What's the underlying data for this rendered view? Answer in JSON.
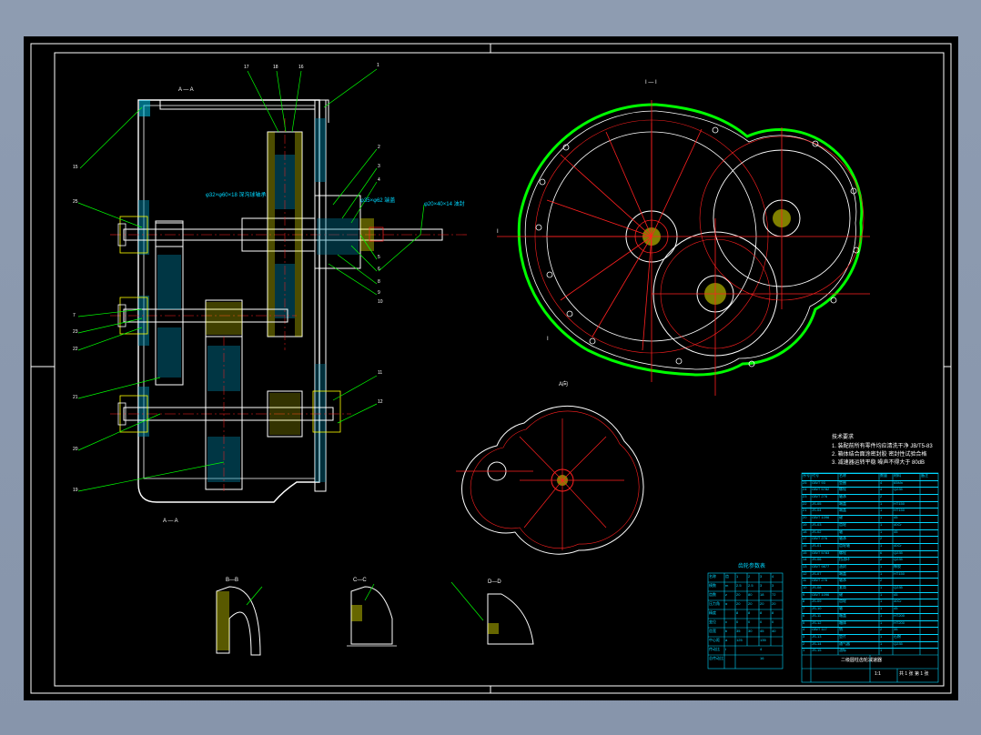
{
  "drawing": {
    "section_aa_label": "A — A",
    "section_bb_label": "B—B",
    "section_cc_label": "C—C",
    "section_dd_label": "D—D",
    "view_label_1": "I — I",
    "view_label_2": "I",
    "view_label_3": "I",
    "small_view_label": "A向",
    "part_numbers_left": [
      "15",
      "25",
      "7",
      "23",
      "22",
      "21",
      "20",
      "19"
    ],
    "part_numbers_top": [
      "17",
      "18",
      "16",
      "1"
    ],
    "part_numbers_right": [
      "2",
      "3",
      "4",
      "5",
      "6",
      "8",
      "9",
      "10",
      "11",
      "12"
    ],
    "callout_note_1": "φ32×φ60×18 深沟球轴承",
    "callout_note_2": "φ35×φ62 端盖",
    "callout_note_3": "φ20×40×14 油封",
    "tech_req_title": "技术要求",
    "tech_req_lines": [
      "1. 装配前所有零件均应清洗干净 JB/T5-83",
      "2. 箱体结合面涂密封胶 密封性试验合格",
      "3. 减速器运转平稳 噪声不得大于 80dB"
    ]
  },
  "param_table": {
    "title": "齿轮参数表",
    "rows": [
      [
        "名称",
        "齿",
        "1",
        "2",
        "3",
        "4"
      ],
      [
        "模数",
        "m",
        "2.5",
        "2.5",
        "3",
        "3"
      ],
      [
        "齿数",
        "z",
        "20",
        "80",
        "18",
        "72"
      ],
      [
        "压力角",
        "α",
        "20",
        "20",
        "20",
        "20"
      ],
      [
        "精度",
        "",
        "8",
        "8",
        "8",
        "8"
      ],
      [
        "变位",
        "x",
        "0",
        "0",
        "0",
        "0"
      ],
      [
        "齿宽",
        "b",
        "35",
        "30",
        "45",
        "40"
      ],
      [
        "中心距",
        "a",
        "125",
        "",
        "135",
        ""
      ],
      [
        "传动比",
        "i",
        "",
        "",
        "4",
        ""
      ],
      [
        "总传动比",
        "",
        "",
        "",
        "16",
        ""
      ]
    ]
  },
  "parts_list": {
    "header": [
      "序号",
      "代号",
      "名称",
      "数量",
      "材料",
      "备注"
    ],
    "rows": [
      [
        "25",
        "GB/T 93",
        "垫圈",
        "4",
        "65Mn",
        ""
      ],
      [
        "24",
        "GB/T 5782",
        "螺栓",
        "4",
        "Q235",
        ""
      ],
      [
        "23",
        "GB/T 276",
        "轴承",
        "2",
        "",
        ""
      ],
      [
        "22",
        "JS-05",
        "端盖",
        "1",
        "HT150",
        ""
      ],
      [
        "21",
        "JS-04",
        "端盖",
        "1",
        "HT150",
        ""
      ],
      [
        "20",
        "GB/T 1096",
        "键",
        "1",
        "45",
        ""
      ],
      [
        "19",
        "JS-03",
        "齿轮",
        "1",
        "40Cr",
        ""
      ],
      [
        "18",
        "JS-02",
        "轴",
        "1",
        "45",
        ""
      ],
      [
        "17",
        "GB/T 276",
        "轴承",
        "2",
        "",
        ""
      ],
      [
        "16",
        "JS-01",
        "齿轮轴",
        "1",
        "40Cr",
        ""
      ],
      [
        "15",
        "GB/T 5783",
        "螺栓",
        "6",
        "Q235",
        ""
      ],
      [
        "14",
        "JS-06",
        "挡油环",
        "2",
        "Q235",
        ""
      ],
      [
        "13",
        "GB/T 9877",
        "油封",
        "1",
        "橡胶",
        ""
      ],
      [
        "12",
        "JS-07",
        "端盖",
        "1",
        "HT150",
        ""
      ],
      [
        "11",
        "GB/T 276",
        "轴承",
        "2",
        "",
        ""
      ],
      [
        "10",
        "JS-08",
        "套筒",
        "1",
        "Q235",
        ""
      ],
      [
        "9",
        "GB/T 1096",
        "键",
        "1",
        "45",
        ""
      ],
      [
        "8",
        "JS-09",
        "齿轮",
        "1",
        "40Cr",
        ""
      ],
      [
        "7",
        "JS-10",
        "轴",
        "1",
        "45",
        ""
      ],
      [
        "6",
        "JS-11",
        "箱盖",
        "1",
        "HT200",
        ""
      ],
      [
        "5",
        "JS-12",
        "箱体",
        "1",
        "HT200",
        ""
      ],
      [
        "4",
        "GB/T 117",
        "销",
        "2",
        "35",
        ""
      ],
      [
        "3",
        "JS-13",
        "垫片",
        "1",
        "石棉",
        ""
      ],
      [
        "2",
        "JS-14",
        "通气器",
        "1",
        "Q235",
        ""
      ],
      [
        "1",
        "JS-15",
        "油标",
        "1",
        "",
        ""
      ]
    ],
    "title_block_name": "二级圆柱齿轮减速器",
    "title_block_scale": "1:1",
    "title_block_sheet": "共 1 张 第 1 张"
  },
  "colors": {
    "background": "#000000",
    "outline": "#ffffff",
    "center_line": "#ff2020",
    "leader": "#00ff00",
    "hatch": "#00d7ff",
    "highlight": "#ffff00",
    "dimension": "#ff00ff"
  }
}
